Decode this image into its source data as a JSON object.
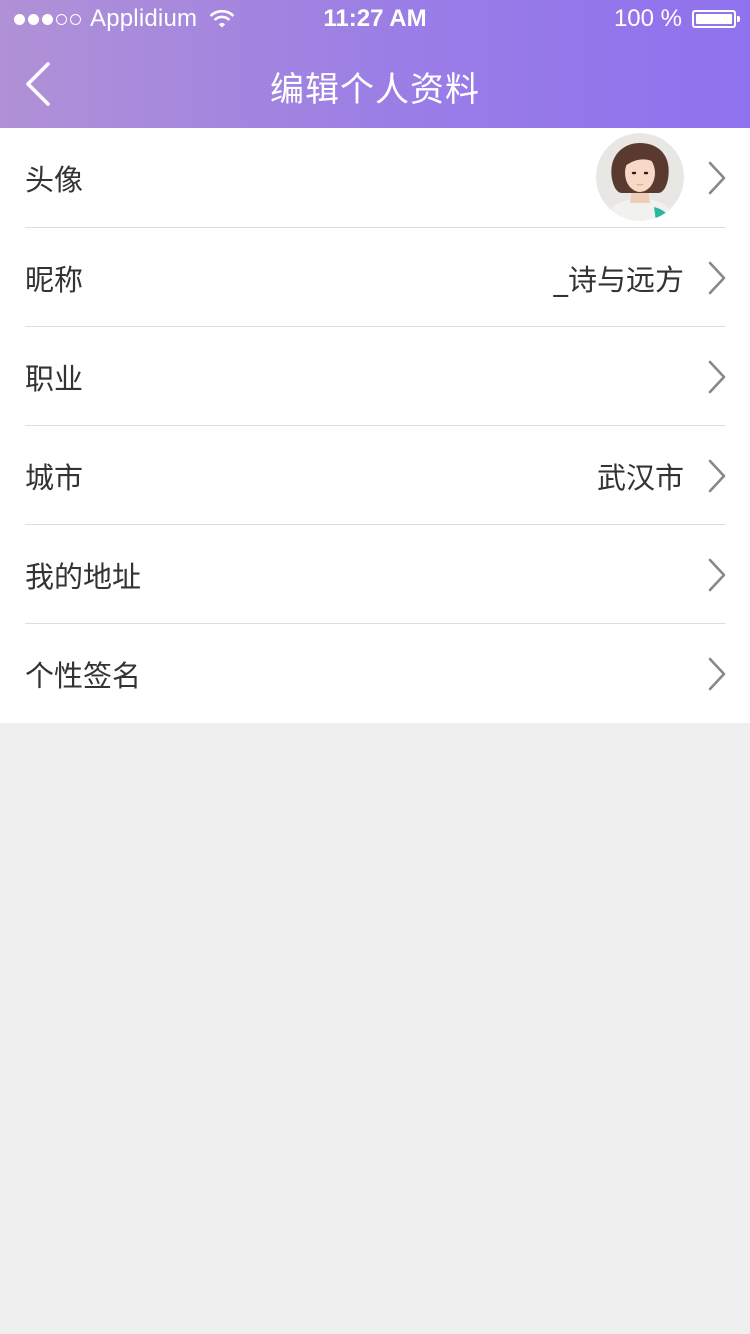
{
  "status_bar": {
    "carrier": "Applidium",
    "time": "11:27 AM",
    "battery": "100 %",
    "signal_bars_filled": 3,
    "signal_bars_total": 5
  },
  "nav": {
    "title": "编辑个人资料",
    "back_icon": "chevron-left-icon"
  },
  "colors": {
    "header_gradient_start": "#b091d6",
    "header_gradient_end": "#8f72ee",
    "background": "#efefef",
    "list_background": "#ffffff",
    "text": "#333333",
    "chevron": "#888888"
  },
  "profile_fields": [
    {
      "label": "头像",
      "value": "",
      "type": "avatar"
    },
    {
      "label": "昵称",
      "value": "_诗与远方"
    },
    {
      "label": "职业",
      "value": ""
    },
    {
      "label": "城市",
      "value": "武汉市"
    },
    {
      "label": "我的地址",
      "value": ""
    },
    {
      "label": "个性签名",
      "value": ""
    }
  ]
}
